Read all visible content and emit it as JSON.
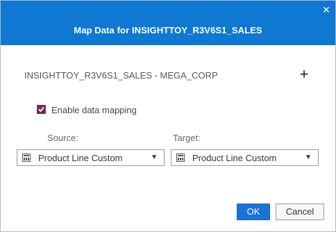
{
  "dialog": {
    "title": "Map Data for INSIGHTTOY_R3V6S1_SALES",
    "close_icon": "close-icon"
  },
  "table": {
    "name": "INSIGHTTOY_R3V6S1_SALES - MEGA_CORP",
    "add_icon": "+"
  },
  "mapping": {
    "enable_label": "Enable data mapping",
    "enabled": true
  },
  "source": {
    "label": "Source:",
    "value": "Product Line Custom",
    "icon": "hierarchy-icon"
  },
  "target": {
    "label": "Target:",
    "value": "Product Line Custom",
    "icon": "hierarchy-icon"
  },
  "buttons": {
    "ok": "OK",
    "cancel": "Cancel"
  },
  "colors": {
    "titlebar": "#0f78d2",
    "checkbox": "#7a2b52",
    "primary_button": "#1c73d6"
  }
}
